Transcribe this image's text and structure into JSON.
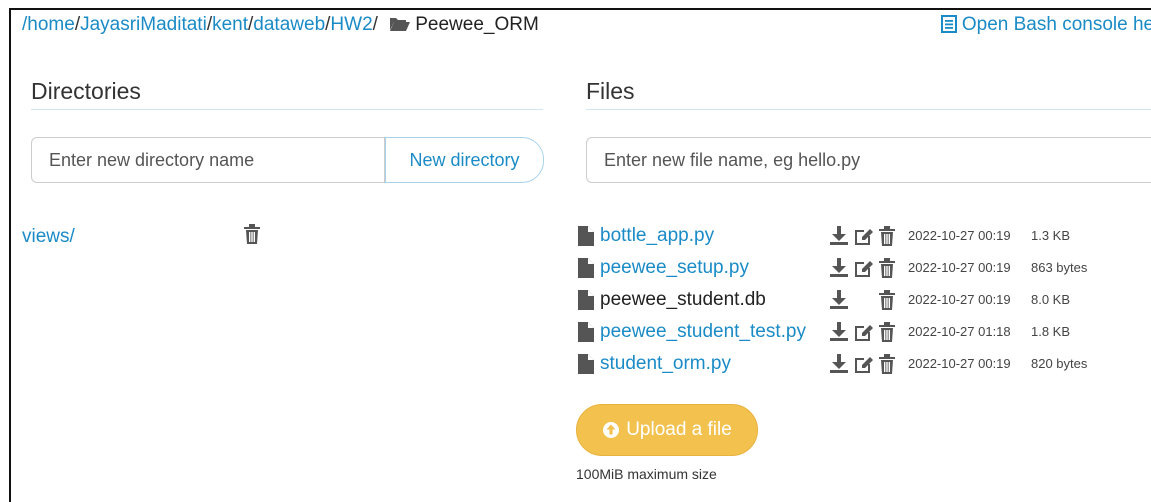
{
  "breadcrumb": {
    "segments": [
      {
        "label": "/home"
      },
      {
        "label": "JayasriMaditati"
      },
      {
        "label": "kent"
      },
      {
        "label": "dataweb"
      },
      {
        "label": "HW2"
      }
    ],
    "current": "Peewee_ORM"
  },
  "bash_link": "Open Bash console here",
  "directories": {
    "title": "Directories",
    "input_placeholder": "Enter new directory name",
    "button_label": "New directory",
    "items": [
      {
        "name": "views/"
      }
    ]
  },
  "files": {
    "title": "Files",
    "input_placeholder": "Enter new file name, eg hello.py",
    "items": [
      {
        "name": "bottle_app.py",
        "modified": "2022-10-27 00:19",
        "size": "1.3 KB",
        "editable": true
      },
      {
        "name": "peewee_setup.py",
        "modified": "2022-10-27 00:19",
        "size": "863 bytes",
        "editable": true
      },
      {
        "name": "peewee_student.db",
        "modified": "2022-10-27 00:19",
        "size": "8.0 KB",
        "editable": false
      },
      {
        "name": "peewee_student_test.py",
        "modified": "2022-10-27 01:18",
        "size": "1.8 KB",
        "editable": true
      },
      {
        "name": "student_orm.py",
        "modified": "2022-10-27 00:19",
        "size": "820 bytes",
        "editable": true
      }
    ]
  },
  "upload": {
    "button_label": "Upload a file",
    "note": "100MiB maximum size"
  },
  "colors": {
    "link": "#1a8bc6",
    "upload": "#f2c14e",
    "rule": "#d4e6f1"
  }
}
